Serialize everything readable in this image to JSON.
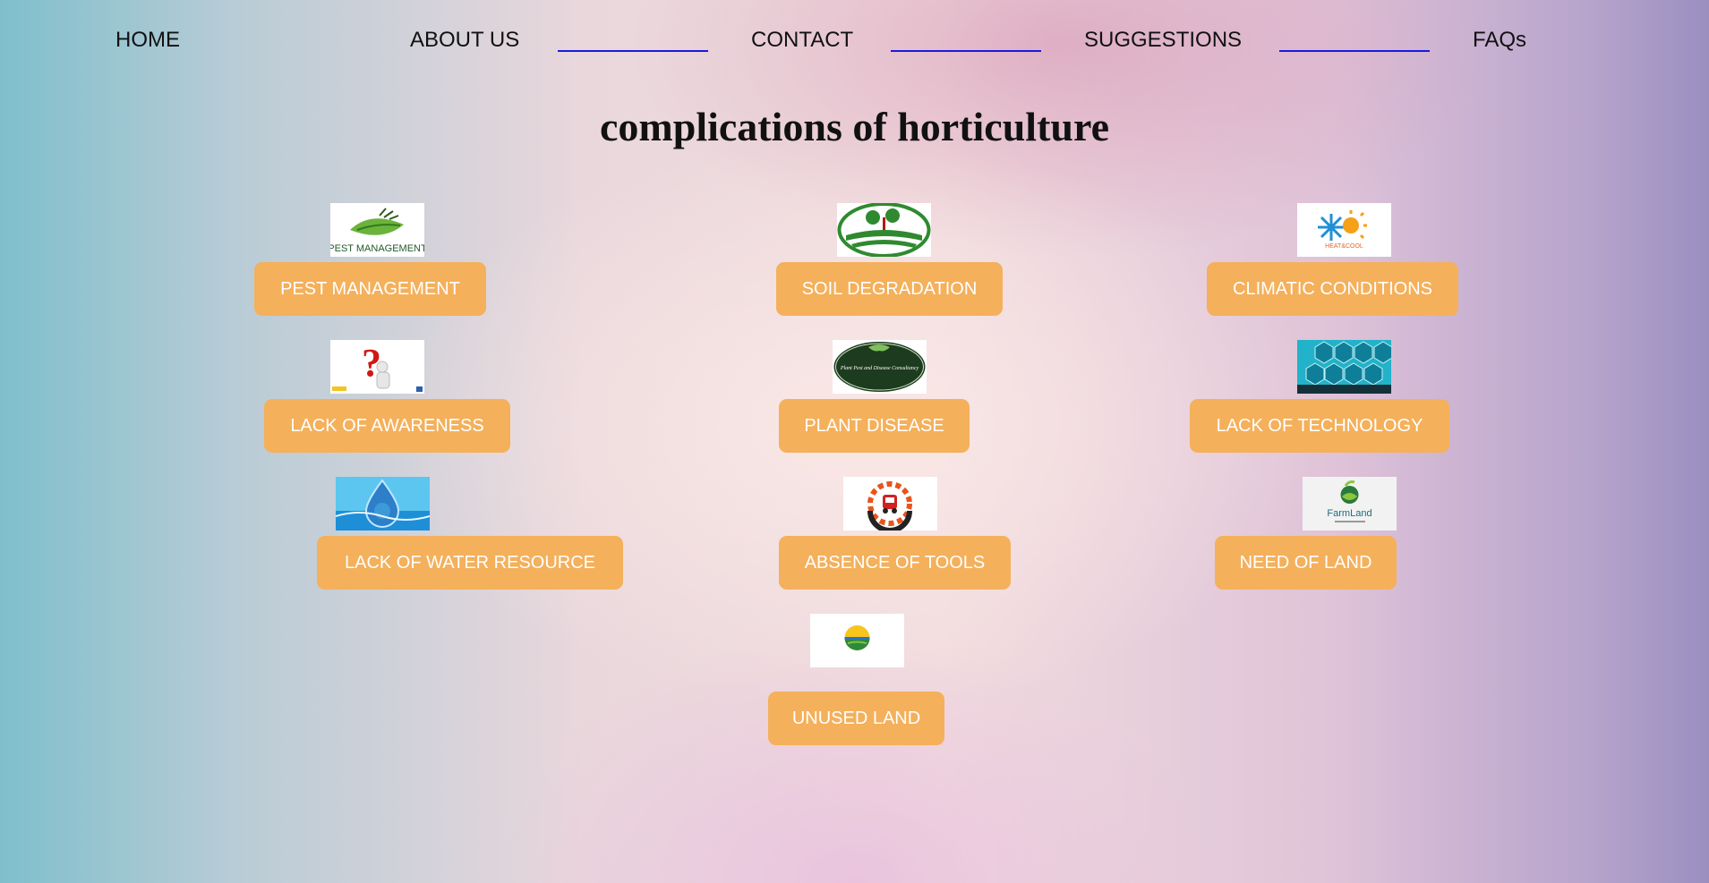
{
  "nav": {
    "home": "HOME",
    "about": "ABOUT US",
    "contact": "CONTACT",
    "suggestions": "SUGGESTIONS",
    "faqs": "FAQs"
  },
  "page_title": "complications of horticulture",
  "thumbnails": {
    "pest_logo_text": "PEST MANAGEMENT",
    "climate_logo_text": "HEAT&COOL",
    "farmland_logo_text": "FarmLand",
    "plant_disease_logo_text": "Plant Pest and Disease Consultancy"
  },
  "topics": {
    "pest_management": "PEST MANAGEMENT",
    "soil_degradation": "SOIL DEGRADATION",
    "climatic_conditions": "CLIMATIC CONDITIONS",
    "lack_of_awareness": "LACK OF AWARENESS",
    "plant_disease": "PLANT DISEASE",
    "lack_of_technology": "LACK OF TECHNOLOGY",
    "lack_of_water_resource": "LACK OF WATER RESOURCE",
    "absence_of_tools": "ABSENCE OF TOOLS",
    "need_of_land": "NEED OF LAND",
    "unused_land": "UNUSED LAND"
  },
  "colors": {
    "button_bg": "#f4b05b",
    "button_text": "#ffffff",
    "nav_separator": "#1a1adf"
  }
}
